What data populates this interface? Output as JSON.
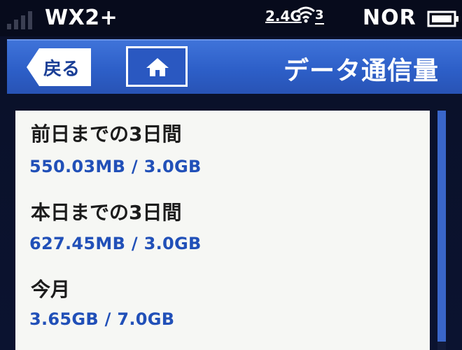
{
  "status_bar": {
    "network_name": "WX2+",
    "band": "2.4G",
    "wifi_clients": "3",
    "mode": "NOR",
    "icons": [
      "signal-icon",
      "wifi-icon",
      "battery-icon"
    ]
  },
  "header": {
    "back_label": "戻る",
    "title": "データ通信量",
    "home_icon": "home-icon"
  },
  "usage_items": [
    {
      "label": "前日までの3日間",
      "value": "550.03MB / 3.0GB"
    },
    {
      "label": "本日までの3日間",
      "value": "627.45MB / 3.0GB"
    },
    {
      "label": "今月",
      "value": "3.65GB / 7.0GB"
    }
  ],
  "colors": {
    "header_blue": "#2d5fc8",
    "value_blue": "#2150b8",
    "panel_background": "#f6f7f4",
    "screen_background": "#0b1330"
  }
}
